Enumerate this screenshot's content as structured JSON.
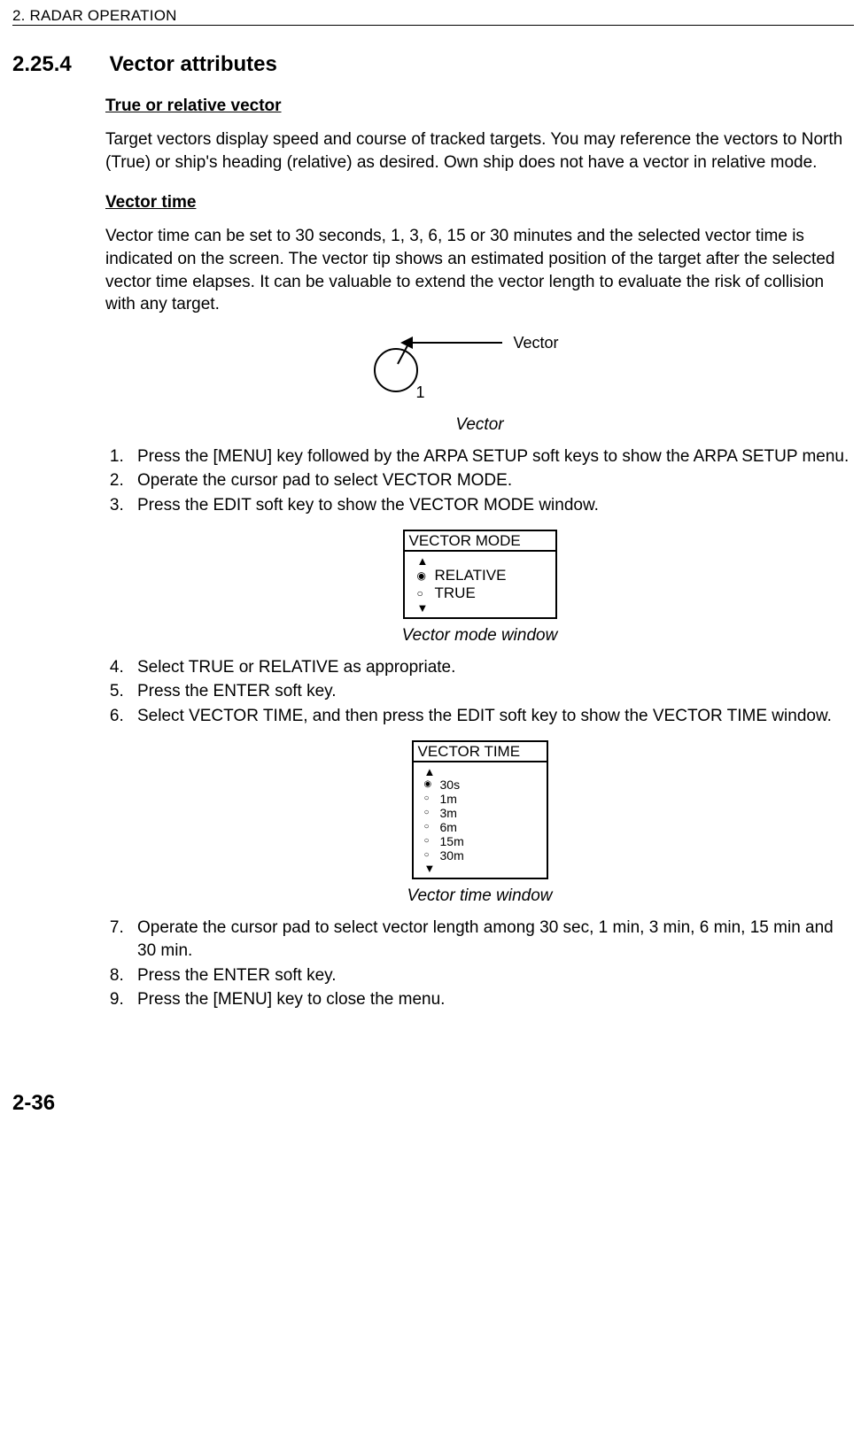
{
  "header": "2. RADAR OPERATION",
  "section": {
    "number": "2.25.4",
    "title": "Vector attributes"
  },
  "true_relative": {
    "heading": "True or relative vector",
    "body": "Target vectors display speed and course of tracked targets. You may reference the vectors to North (True) or ship's heading (relative) as desired. Own ship does not have a vector in relative mode."
  },
  "vector_time": {
    "heading": "Vector time",
    "body": "Vector time can be set to 30 seconds, 1, 3, 6, 15 or 30 minutes and the selected vector time is indicated on the screen. The vector tip shows an estimated position of the target after the selected vector time elapses. It can be valuable to extend the vector length to evaluate the risk of collision with any target."
  },
  "diagram": {
    "pointer_label": "Vector",
    "target_num": "1",
    "caption": "Vector"
  },
  "steps_a": {
    "1": "Press the [MENU] key followed by the ARPA SETUP soft keys to show the ARPA SETUP menu.",
    "2": "Operate the cursor pad to select VECTOR MODE.",
    "3": "Press the EDIT soft key to show the VECTOR MODE window."
  },
  "mode_window": {
    "title": "VECTOR MODE",
    "options": [
      "RELATIVE",
      "TRUE"
    ],
    "selected_index": 0,
    "caption": "Vector mode window"
  },
  "steps_b": {
    "4": "Select TRUE or RELATIVE as appropriate.",
    "5": "Press the ENTER soft key.",
    "6": "Select VECTOR TIME, and then press the EDIT soft key to show the VECTOR TIME window."
  },
  "time_window": {
    "title": "VECTOR TIME",
    "options": [
      "30s",
      "1m",
      "3m",
      "6m",
      "15m",
      "30m"
    ],
    "selected_index": 0,
    "caption": "Vector time window"
  },
  "steps_c": {
    "7": "Operate the cursor pad to select vector length among 30 sec, 1 min, 3 min, 6 min, 15 min and 30 min.",
    "8": "Press the ENTER soft key.",
    "9": "Press the [MENU] key to close the menu."
  },
  "page_number": "2-36"
}
